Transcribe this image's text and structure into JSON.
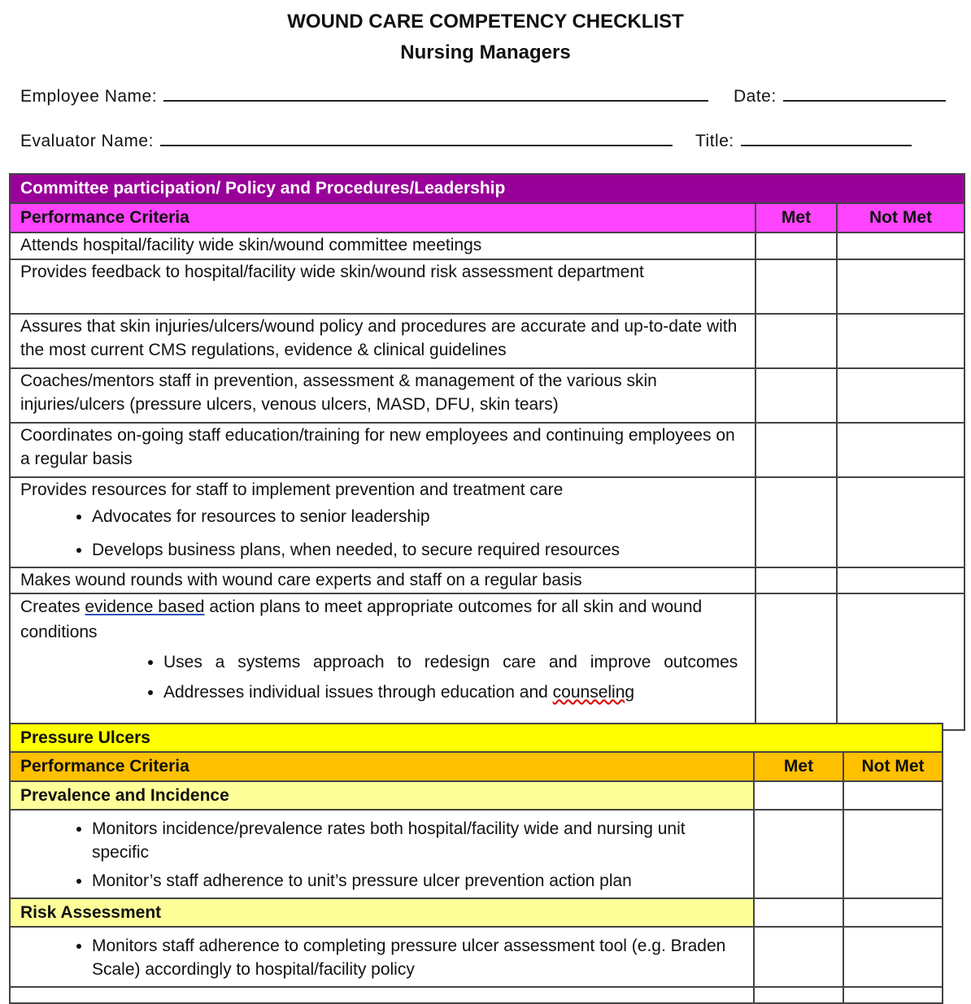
{
  "title": "WOUND CARE COMPETENCY  CHECKLIST",
  "subtitle": "Nursing Managers",
  "fields": {
    "employee": "Employee Name:",
    "date": "Date:",
    "evaluator": "Evaluator Name:",
    "title": "Title:"
  },
  "section1": {
    "header": "Committee participation/ Policy and Procedures/Leadership",
    "criteria_label": "Performance Criteria",
    "met_label": "Met",
    "notmet_label": "Not Met",
    "colors": {
      "header": "#990099",
      "subheader": "#ff44ff"
    },
    "rows": [
      "Attends hospital/facility wide skin/wound committee meetings",
      "Provides feedback to hospital/facility wide skin/wound risk assessment department",
      "Assures that skin injuries/ulcers/wound policy and procedures are accurate and up-to-date with the most current CMS regulations, evidence & clinical guidelines",
      "Coaches/mentors staff in prevention, assessment & management of the various skin injuries/ulcers (pressure ulcers, venous ulcers, MASD, DFU, skin tears)",
      "Coordinates on-going staff education/training for new employees and continuing employees on a regular basis",
      "Provides resources for staff to implement prevention and treatment care",
      "Makes wound rounds with wound care experts and staff on a regular basis"
    ],
    "row6_bullets": [
      "Advocates for resources to senior leadership",
      "Develops business plans, when needed, to secure required resources"
    ],
    "row8": {
      "pre": "Creates ",
      "underlined": "evidence based",
      "post": " action plans to meet appropriate outcomes for all skin and wound conditions",
      "bullets": [
        "Uses a systems approach to redesign care and improve outcomes"
      ],
      "last_bullet_pre": "Addresses individual issues through education and ",
      "last_bullet_underlined": "counseling"
    }
  },
  "section2": {
    "header": "Pressure Ulcers",
    "criteria_label": "Performance Criteria",
    "met_label": "Met",
    "notmet_label": "Not Met",
    "colors": {
      "header": "#ffff00",
      "subheader": "#ffc000",
      "subsection": "#ffff99"
    },
    "prevalence": {
      "label": "Prevalence and Incidence",
      "bullets": [
        "Monitors incidence/prevalence rates both hospital/facility wide and nursing unit specific",
        "Monitor’s staff adherence to unit’s pressure ulcer prevention action plan"
      ]
    },
    "risk": {
      "label": "Risk Assessment",
      "bullets": [
        "Monitors staff adherence to completing pressure ulcer assessment tool (e.g. Braden Scale) accordingly to hospital/facility policy"
      ]
    }
  }
}
